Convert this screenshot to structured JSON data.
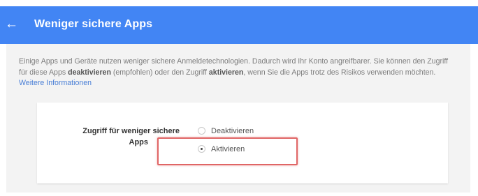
{
  "header": {
    "back_icon": "arrow-left-icon",
    "title": "Weniger sichere Apps",
    "background": "#4285f4"
  },
  "intro": {
    "text_part1": "Einige Apps und Geräte nutzen weniger sichere Anmeldetechnologien. Dadurch wird Ihr Konto angreifbarer. Sie können den Zugriff für diese Apps ",
    "bold_deactivate": "deaktivieren",
    "text_part2": " (empfohlen) oder den Zugriff ",
    "bold_activate": "aktivieren",
    "text_part3": ", wenn Sie die Apps trotz des Risikos verwenden möchten. ",
    "link": "Weitere Informationen"
  },
  "setting": {
    "label_line1": "Zugriff für weniger sichere",
    "label_line2": "Apps",
    "options": [
      {
        "label": "Deaktivieren",
        "selected": false
      },
      {
        "label": "Aktivieren",
        "selected": true
      }
    ]
  },
  "colors": {
    "highlight": "#e06666",
    "link": "#4a7fd6"
  }
}
